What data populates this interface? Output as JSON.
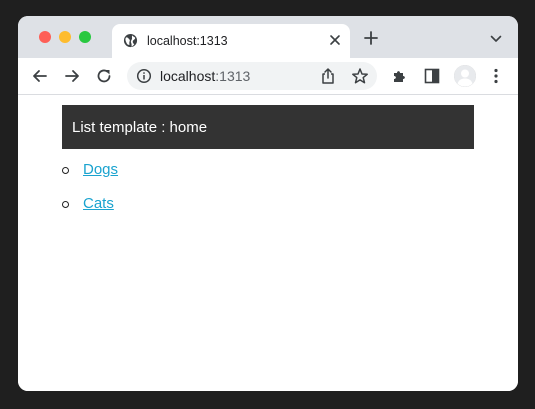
{
  "tab": {
    "title": "localhost:1313"
  },
  "omnibox": {
    "host": "localhost",
    "port": ":1313"
  },
  "page": {
    "header": "List template : home",
    "links": [
      {
        "label": "Dogs"
      },
      {
        "label": "Cats"
      }
    ]
  }
}
